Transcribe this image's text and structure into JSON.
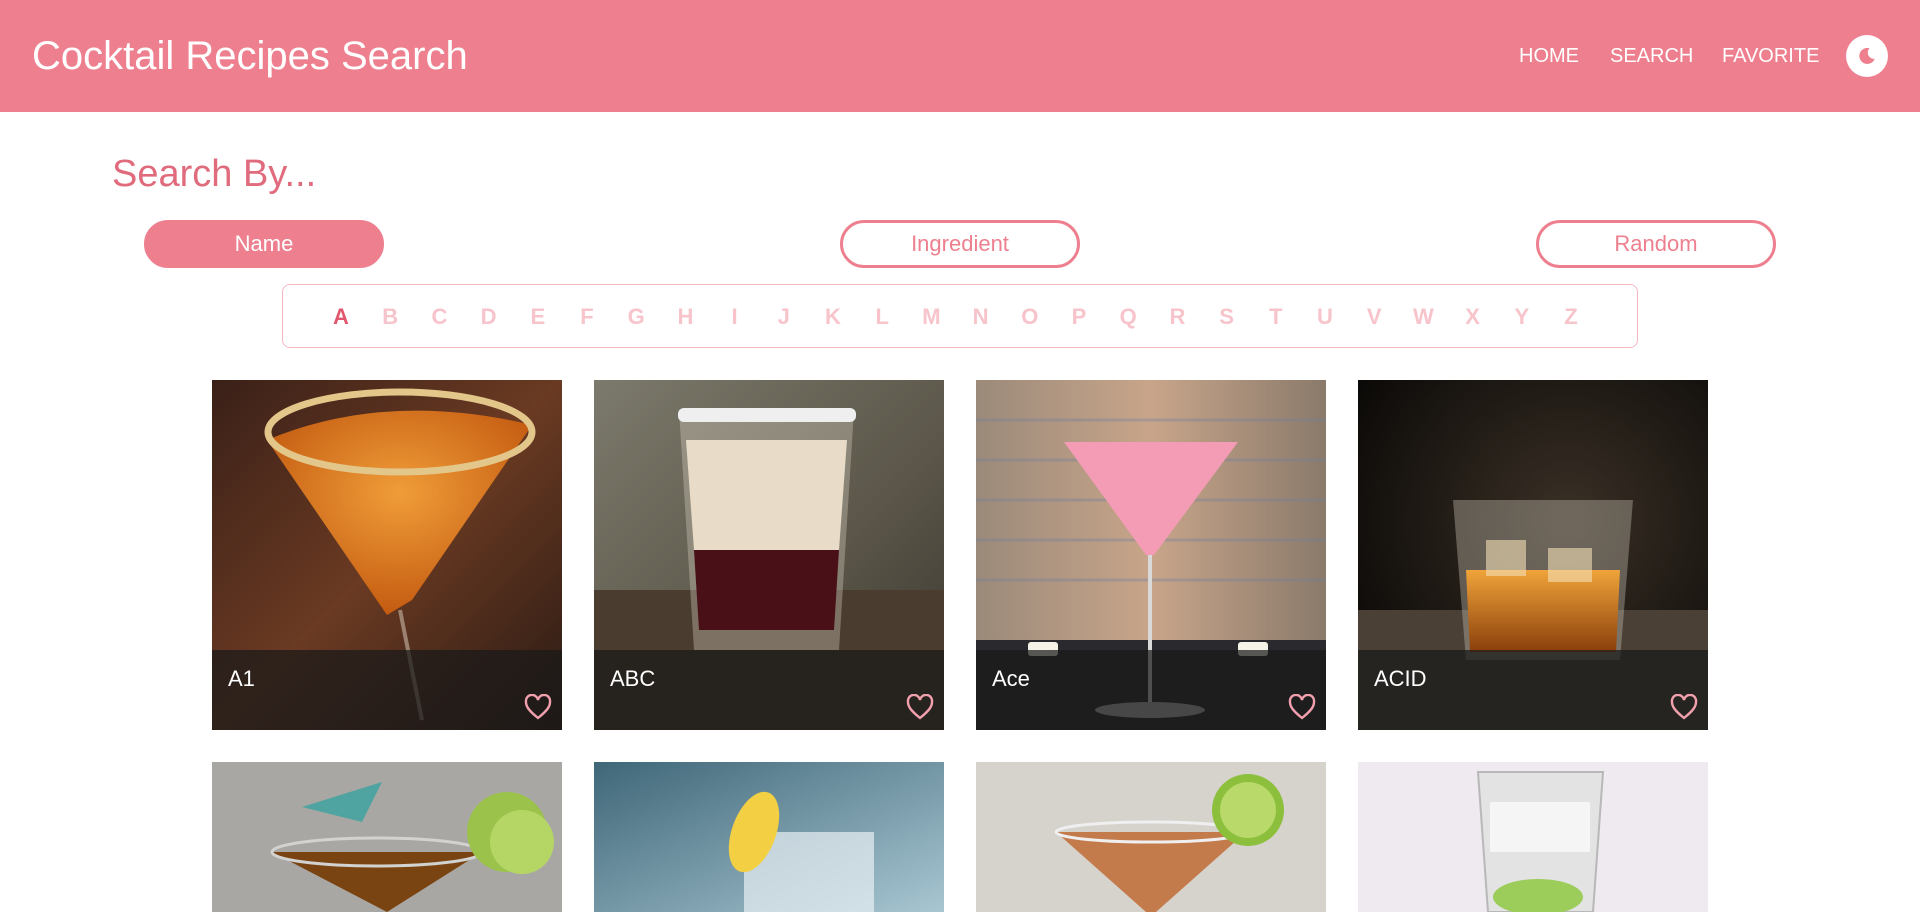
{
  "header": {
    "title": "Cocktail Recipes Search",
    "nav": [
      "HOME",
      "SEARCH",
      "FAVORITE"
    ],
    "theme_icon": "moon-icon",
    "accent_color": "#ee7f8e"
  },
  "search": {
    "heading": "Search By...",
    "modes": [
      "Name",
      "Ingredient",
      "Random"
    ],
    "active_mode": "Name",
    "letters": [
      "A",
      "B",
      "C",
      "D",
      "E",
      "F",
      "G",
      "H",
      "I",
      "J",
      "K",
      "L",
      "M",
      "N",
      "O",
      "P",
      "Q",
      "R",
      "S",
      "T",
      "U",
      "V",
      "W",
      "X",
      "Y",
      "Z"
    ],
    "active_letter": "A"
  },
  "cocktails": [
    {
      "name": "A1"
    },
    {
      "name": "ABC"
    },
    {
      "name": "Ace"
    },
    {
      "name": "ACID"
    },
    {
      "name": ""
    },
    {
      "name": ""
    },
    {
      "name": ""
    },
    {
      "name": ""
    }
  ]
}
